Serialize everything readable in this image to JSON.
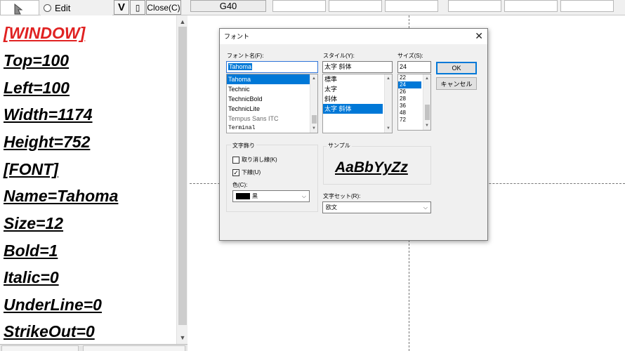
{
  "toolbar": {
    "edit_label": "Edit",
    "v_label": "V",
    "clip_label": "▯",
    "close_label": "Close(C)",
    "cell_ref": "G40"
  },
  "editor": {
    "lines": [
      "[WINDOW]",
      "Top=100",
      "Left=100",
      "Width=1174",
      "Height=752",
      "[FONT]",
      "Name=Tahoma",
      "Size=12",
      "Bold=1",
      "Italic=0",
      "UnderLine=0",
      "StrikeOut=0"
    ],
    "highlight_color": "#e02222"
  },
  "dialog": {
    "title": "フォント",
    "font_name_label": "フォント名(F):",
    "font_name_value": "Tahoma",
    "font_list": [
      "Tahoma",
      "Technic",
      "TechnicBold",
      "TechnicLite",
      "Tempus Sans ITC",
      "Terminal"
    ],
    "style_label": "スタイル(Y):",
    "style_value": "太字 斜体",
    "style_list": [
      "標準",
      "太字",
      "斜体",
      "太字 斜体"
    ],
    "size_label": "サイズ(S):",
    "size_value": "24",
    "size_list": [
      "22",
      "24",
      "26",
      "28",
      "36",
      "48",
      "72"
    ],
    "ok_label": "OK",
    "cancel_label": "キャンセル",
    "effects_label": "文字飾り",
    "strike_label": "取り消し線(K)",
    "underline_label": "下線(U)",
    "color_label": "色(C):",
    "color_value": "黒",
    "sample_label": "サンプル",
    "sample_text": "AaBbYyZz",
    "charset_label": "文字セット(R):",
    "charset_value": "欧文",
    "selection_color": "#0078d7"
  }
}
